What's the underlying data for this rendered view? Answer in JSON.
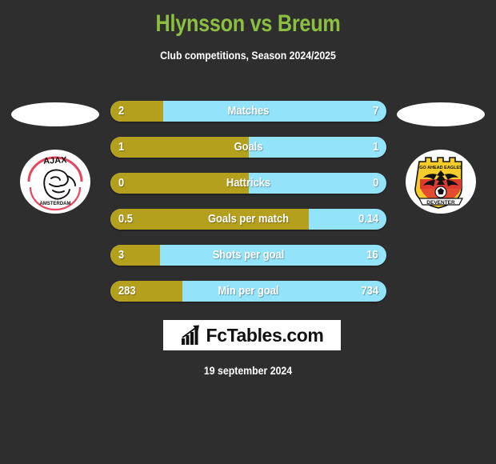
{
  "header": {
    "title": "Hlynsson vs Breum",
    "subtitle": "Club competitions, Season 2024/2025"
  },
  "teams": {
    "home": {
      "crest_name": "ajax-amsterdam-crest",
      "crest_text_top": "AJAX",
      "crest_text_bottom": "AMSTERDAM",
      "photo_name": "player-photo-home"
    },
    "away": {
      "crest_name": "go-ahead-eagles-crest",
      "crest_text_top": "GO AHEAD EAGLES",
      "crest_text_bottom": "DEVENTER",
      "photo_name": "player-photo-away"
    }
  },
  "chart_data": {
    "type": "bar",
    "title": "Hlynsson vs Breum",
    "subtitle": "Club competitions, Season 2024/2025",
    "orientation": "horizontal-dual",
    "series": [
      {
        "name": "Hlynsson",
        "color": "#b5a01e"
      },
      {
        "name": "Breum",
        "color": "#93e3fb"
      }
    ],
    "categories": [
      "Matches",
      "Goals",
      "Hattricks",
      "Goals per match",
      "Shots per goal",
      "Min per goal"
    ],
    "rows": [
      {
        "label": "Matches",
        "home": "2",
        "away": "7",
        "fill_pct": 19
      },
      {
        "label": "Goals",
        "home": "1",
        "away": "1",
        "fill_pct": 50
      },
      {
        "label": "Hattricks",
        "home": "0",
        "away": "0",
        "fill_pct": 50
      },
      {
        "label": "Goals per match",
        "home": "0.5",
        "away": "0.14",
        "fill_pct": 72
      },
      {
        "label": "Shots per goal",
        "home": "3",
        "away": "16",
        "fill_pct": 18
      },
      {
        "label": "Min per goal",
        "home": "283",
        "away": "734",
        "fill_pct": 26
      }
    ],
    "colors": {
      "background": "#2e2e2e",
      "accent_title": "#8cbe3f",
      "home_bar": "#b5a01e",
      "away_bar": "#93e3fb",
      "text": "#ffffff"
    }
  },
  "footer": {
    "brand": "FcTables.com",
    "brand_icon": "bar-chart-icon",
    "date": "19 september 2024"
  }
}
